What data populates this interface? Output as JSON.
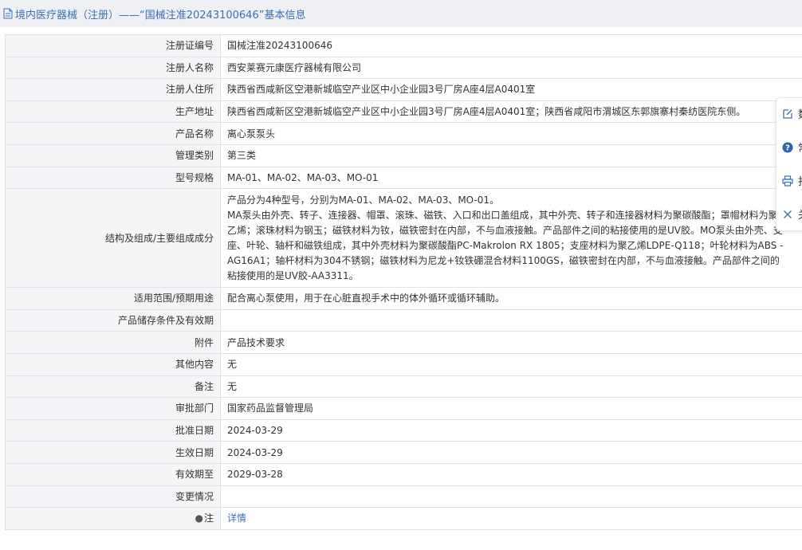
{
  "header": {
    "title": "境内医疗器械（注册）——“国械注准20243100646”基本信息"
  },
  "rows": [
    {
      "label": "注册证编号",
      "value": "国械注准20243100646"
    },
    {
      "label": "注册人名称",
      "value": "西安莱赛元康医疗器械有限公司"
    },
    {
      "label": "注册人住所",
      "value": "陕西省西咸新区空港新城临空产业区中小企业园3号厂房A座4层A0401室"
    },
    {
      "label": "生产地址",
      "value": "陕西省西咸新区空港新城临空产业区中小企业园3号厂房A座4层A0401室；陕西省咸阳市渭城区东郭旗寨村秦纺医院东侧。"
    },
    {
      "label": "产品名称",
      "value": "离心泵泵头"
    },
    {
      "label": "管理类别",
      "value": "第三类"
    },
    {
      "label": "型号规格",
      "value": "MA-01、MA-02、MA-03、MO-01"
    },
    {
      "label": "结构及组成/主要组成成分",
      "value": "产品分为4种型号，分别为MA-01、MA-02、MA-03、MO-01。\nMA泵头由外壳、转子、连接器、帽罩、滚珠、磁铁、入口和出口盖组成，其中外壳、转子和连接器材料为聚碳酸酯；罩帽材料为聚乙烯；滚珠材料为钢玉；磁铁材料为钕，磁铁密封在内部，不与血液接触。产品部件之间的粘接使用的是UV胶。MO泵头由外壳、支座、叶轮、轴杆和磁铁组成，其中外壳材料为聚碳酸酯PC-Makrolon RX 1805；支座材料为聚乙烯LDPE-Q118；叶轮材料为ABS -AG16A1；轴杆材料为304不锈钢；磁铁材料为尼龙+钕铁硼混合材料1100GS，磁铁密封在内部，不与血液接触。产品部件之间的粘接使用的是UV胶-AA3311。"
    },
    {
      "label": "适用范围/预期用途",
      "value": "配合离心泵使用，用于在心脏直视手术中的体外循环或循环辅助。"
    },
    {
      "label": "产品储存条件及有效期",
      "value": ""
    },
    {
      "label": "附件",
      "value": "产品技术要求"
    },
    {
      "label": "其他内容",
      "value": "无"
    },
    {
      "label": "备注",
      "value": "无"
    },
    {
      "label": "审批部门",
      "value": "国家药品监督管理局"
    },
    {
      "label": "批准日期",
      "value": "2024-03-29"
    },
    {
      "label": "生效日期",
      "value": "2024-03-29"
    },
    {
      "label": "有效期至",
      "value": "2029-03-28"
    },
    {
      "label": "变更情况",
      "value": ""
    }
  ],
  "note_row": {
    "label": "注",
    "link": "详情"
  },
  "toolbar": {
    "items": [
      {
        "label": "数",
        "icon": "edit-icon"
      },
      {
        "label": "常",
        "icon": "help-icon"
      },
      {
        "label": "打",
        "icon": "print-icon"
      },
      {
        "label": "关",
        "icon": "close-icon"
      }
    ]
  },
  "colors": {
    "accent": "#3a6fb3",
    "label_bg": "#f4f5f7",
    "border": "#dfe3e8",
    "header_bg": "#eef0f4"
  }
}
